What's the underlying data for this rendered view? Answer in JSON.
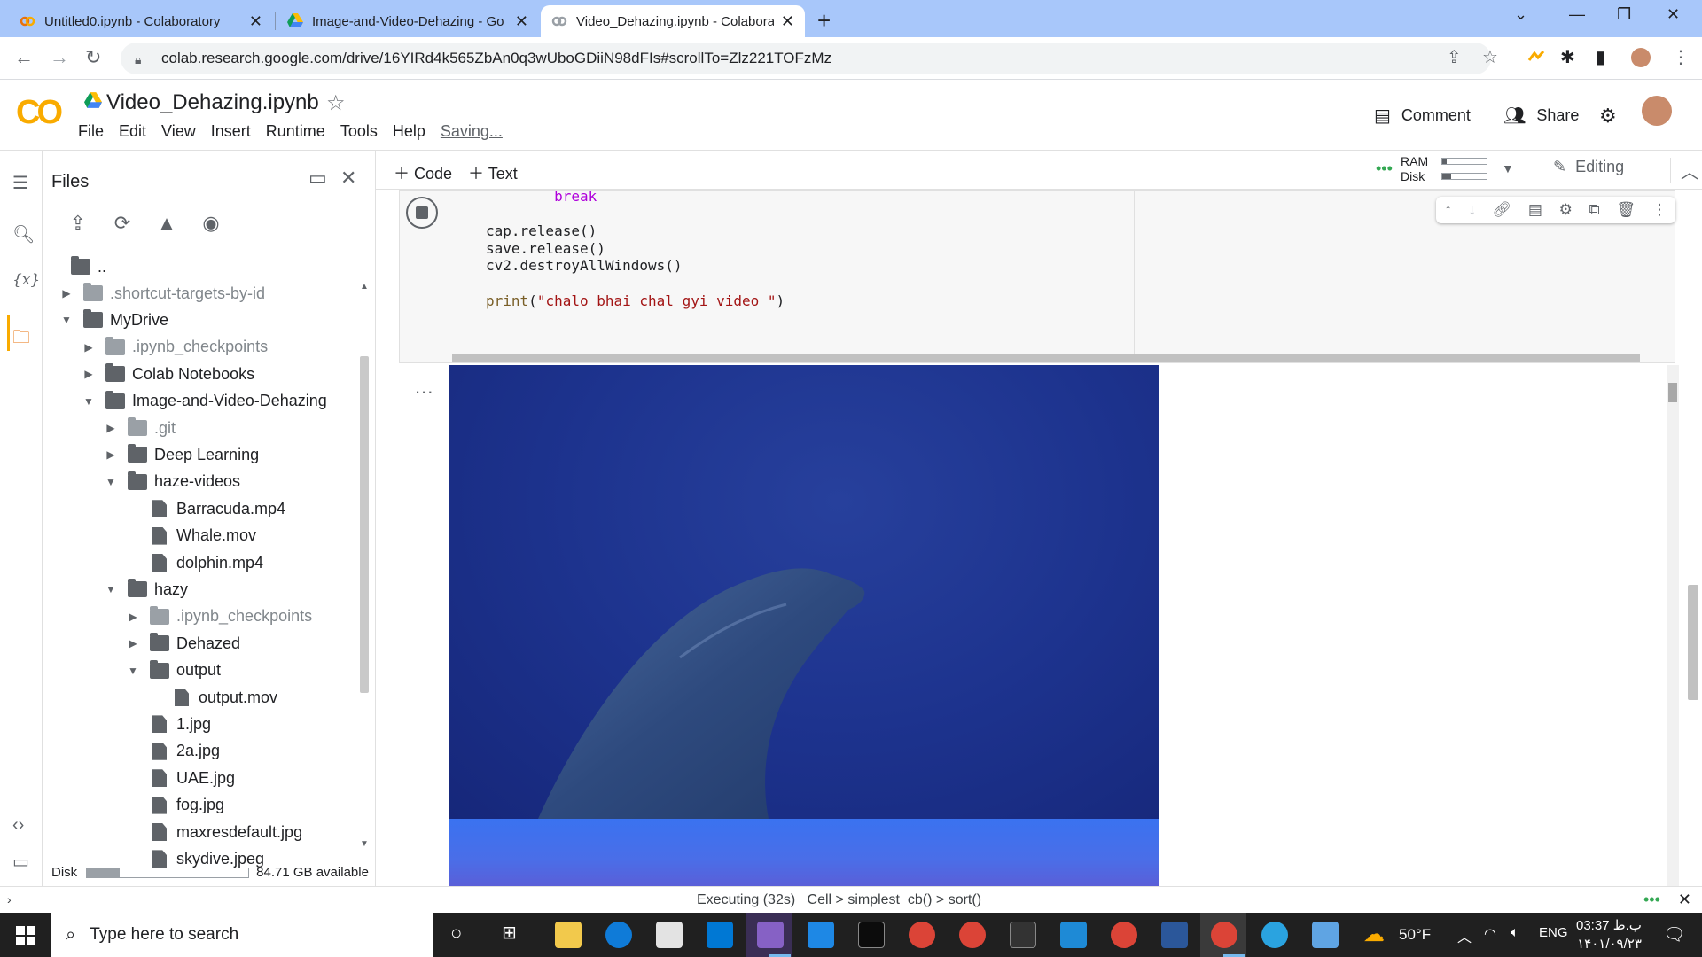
{
  "browser": {
    "tabs": [
      {
        "title": "Untitled0.ipynb - Colaboratory",
        "icon": "colab-icon"
      },
      {
        "title": "Image-and-Video-Dehazing - Go",
        "icon": "google-drive-icon"
      },
      {
        "title": "Video_Dehazing.ipynb - Colabora",
        "icon": "colab-icon",
        "active": true
      }
    ],
    "url": "colab.research.google.com/drive/16YIRd4k565ZbAn0q3wUboGDiiN98dFIs#scrollTo=Zlz221TOFzMz"
  },
  "colab": {
    "logo": "CO",
    "notebook_title": "Video_Dehazing.ipynb",
    "menu": [
      "File",
      "Edit",
      "View",
      "Insert",
      "Runtime",
      "Tools",
      "Help"
    ],
    "saving": "Saving...",
    "comment_label": "Comment",
    "share_label": "Share",
    "toolbar": {
      "code_label": "Code",
      "text_label": "Text",
      "ram_label": "RAM",
      "disk_label": "Disk",
      "editing_label": "Editing",
      "ram_fraction": 0.1,
      "disk_fraction": 0.2
    }
  },
  "files": {
    "title": "Files",
    "parent": "..",
    "tree": [
      {
        "name": ".shortcut-targets-by-id",
        "kind": "folder",
        "depth": 0,
        "arrow": "right",
        "dim": true
      },
      {
        "name": "MyDrive",
        "kind": "folder",
        "depth": 0,
        "arrow": "down"
      },
      {
        "name": ".ipynb_checkpoints",
        "kind": "folder",
        "depth": 1,
        "arrow": "right",
        "dim": true
      },
      {
        "name": "Colab Notebooks",
        "kind": "folder",
        "depth": 1,
        "arrow": "right"
      },
      {
        "name": "Image-and-Video-Dehazing",
        "kind": "folder",
        "depth": 1,
        "arrow": "down"
      },
      {
        "name": ".git",
        "kind": "folder",
        "depth": 2,
        "arrow": "right",
        "dim": true
      },
      {
        "name": "Deep Learning",
        "kind": "folder",
        "depth": 2,
        "arrow": "right"
      },
      {
        "name": "haze-videos",
        "kind": "folder",
        "depth": 2,
        "arrow": "down"
      },
      {
        "name": "Barracuda.mp4",
        "kind": "file",
        "depth": 3
      },
      {
        "name": "Whale.mov",
        "kind": "file",
        "depth": 3
      },
      {
        "name": "dolphin.mp4",
        "kind": "file",
        "depth": 3
      },
      {
        "name": "hazy",
        "kind": "folder",
        "depth": 2,
        "arrow": "down"
      },
      {
        "name": ".ipynb_checkpoints",
        "kind": "folder",
        "depth": 3,
        "arrow": "right",
        "dim": true
      },
      {
        "name": "Dehazed",
        "kind": "folder",
        "depth": 3,
        "arrow": "right"
      },
      {
        "name": "output",
        "kind": "folder",
        "depth": 3,
        "arrow": "down"
      },
      {
        "name": "output.mov",
        "kind": "file",
        "depth": 4
      },
      {
        "name": "1.jpg",
        "kind": "file",
        "depth": 3
      },
      {
        "name": "2a.jpg",
        "kind": "file",
        "depth": 3
      },
      {
        "name": "UAE.jpg",
        "kind": "file",
        "depth": 3
      },
      {
        "name": "fog.jpg",
        "kind": "file",
        "depth": 3
      },
      {
        "name": "maxresdefault.jpg",
        "kind": "file",
        "depth": 3
      },
      {
        "name": "skydive.jpeg",
        "kind": "file",
        "depth": 3
      }
    ],
    "disk_label": "Disk",
    "disk_available": "84.71 GB available",
    "disk_fraction": 0.2
  },
  "cell": {
    "code_lines": [
      {
        "text": "        break",
        "cls": "kw"
      },
      {
        "text": "",
        "cls": ""
      },
      {
        "text": "cap.release()",
        "cls": ""
      },
      {
        "text": "save.release()",
        "cls": ""
      },
      {
        "text": "cv2.destroyAllWindows()",
        "cls": ""
      },
      {
        "text": "",
        "cls": ""
      },
      {
        "text": "print(\"chalo bhai chal gyi video \")",
        "cls": "print"
      }
    ],
    "output_menu": "..."
  },
  "statusbar": {
    "executing": "Executing (32s)",
    "crumbs": [
      "Cell",
      "simplest_cb()",
      "sort()"
    ]
  },
  "taskbar": {
    "search_placeholder": "Type here to search",
    "weather": "50°F",
    "lang": "ENG",
    "time": "03:37 ب.ظ",
    "date": "۱۴۰۱/۰۹/۲۳"
  }
}
